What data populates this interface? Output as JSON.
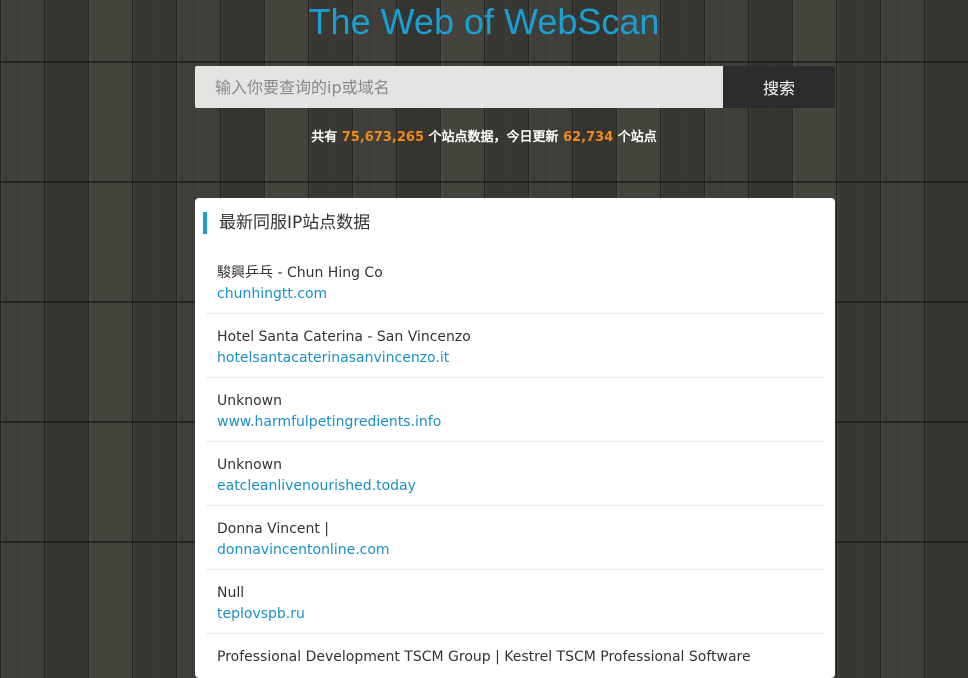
{
  "header": {
    "title": "The Web of WebScan"
  },
  "search": {
    "placeholder": "输入你要查询的ip或域名",
    "value": "",
    "button_label": "搜索"
  },
  "stats": {
    "prefix": "共有",
    "total_sites": "75,673,265",
    "middle": "个站点数据，今日更新",
    "updated_today": "62,734",
    "suffix": "个站点"
  },
  "panel": {
    "title": "最新同服IP站点数据",
    "accent_color": "#1a9fd3",
    "items": [
      {
        "name": "駿興乒乓 - Chun Hing Co",
        "domain": "chunhingtt.com"
      },
      {
        "name": "Hotel Santa Caterina - San Vincenzo",
        "domain": "hotelsantacaterinasanvincenzo.it"
      },
      {
        "name": "Unknown",
        "domain": "www.harmfulpetingredients.info"
      },
      {
        "name": "Unknown",
        "domain": "eatcleanlivenourished.today"
      },
      {
        "name": "Donna Vincent |",
        "domain": "donnavincentonline.com"
      },
      {
        "name": "Null",
        "domain": "teplovspb.ru"
      },
      {
        "name": "Professional Development TSCM Group | Kestrel TSCM Professional Software",
        "domain": ""
      }
    ]
  }
}
